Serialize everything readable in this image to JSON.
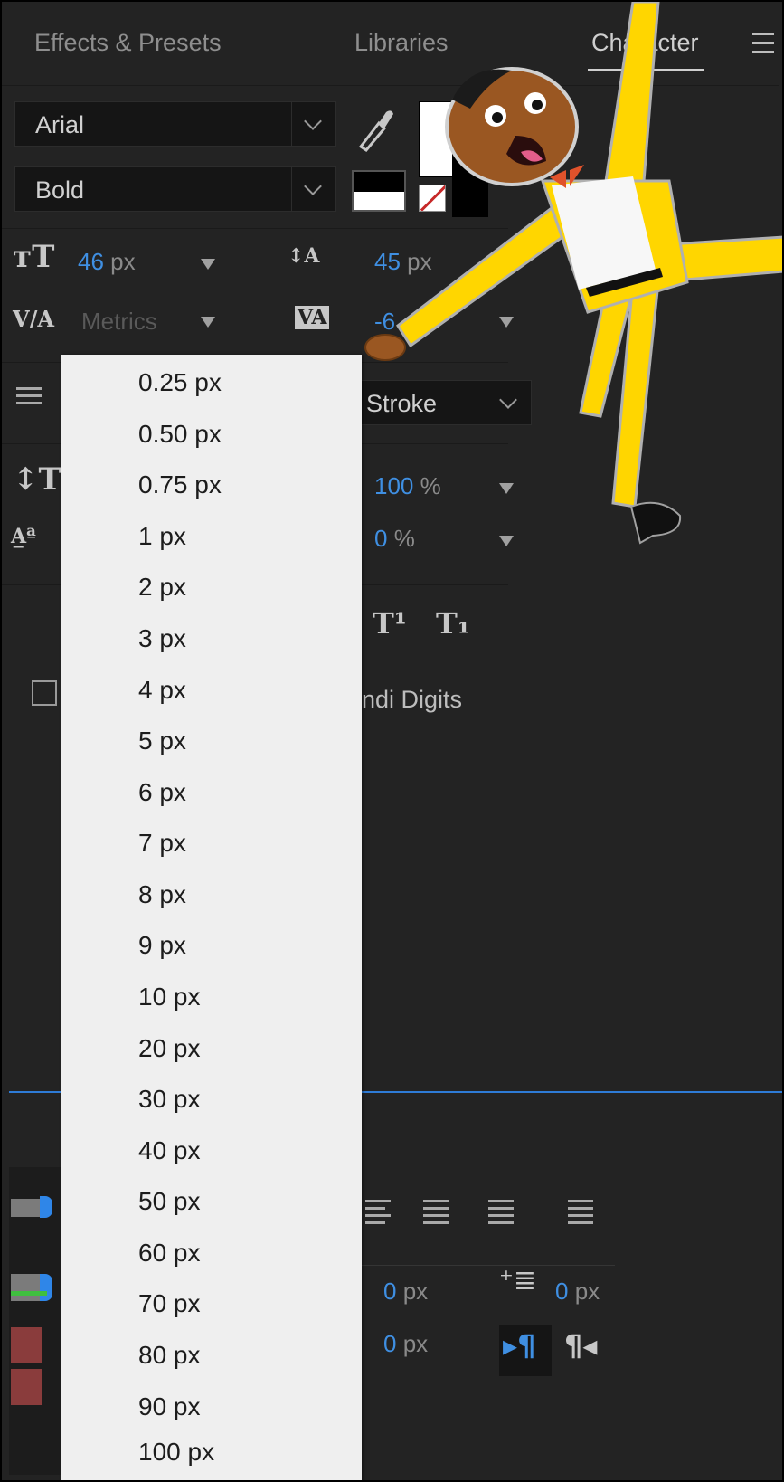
{
  "tabs": [
    "Effects & Presets",
    "Libraries",
    "Character"
  ],
  "active_tab": "Character",
  "font_family": "Arial",
  "font_style": "Bold",
  "font_size": {
    "value": "46",
    "unit": "px"
  },
  "leading": {
    "value": "45",
    "unit": "px"
  },
  "kerning": "Metrics",
  "tracking": "-6",
  "stroke_mode": "Stroke",
  "vertical_scale": {
    "value": "100",
    "unit": "%"
  },
  "tsume": {
    "value": "0",
    "unit": "%"
  },
  "hindi_digits_label": "ndi Digits",
  "indent_left": {
    "value": "0",
    "unit": "px"
  },
  "indent_first": {
    "value": "0",
    "unit": "px"
  },
  "space_before": {
    "value": "0",
    "unit": "px"
  },
  "colors": {
    "accent_blue": "#3f8fe2",
    "panel_bg": "#232323",
    "menu_bg": "#efefef",
    "highlight_line": "#2e7bd6"
  },
  "stroke_width_menu": {
    "items": [
      "0.25 px",
      "0.50 px",
      "0.75 px",
      "1 px",
      "2 px",
      "3 px",
      "4 px",
      "5 px",
      "6 px",
      "7 px",
      "8 px",
      "9 px",
      "10 px",
      "20 px",
      "30 px",
      "40 px",
      "50 px",
      "60 px",
      "70 px",
      "80 px",
      "90 px",
      "100 px"
    ]
  }
}
